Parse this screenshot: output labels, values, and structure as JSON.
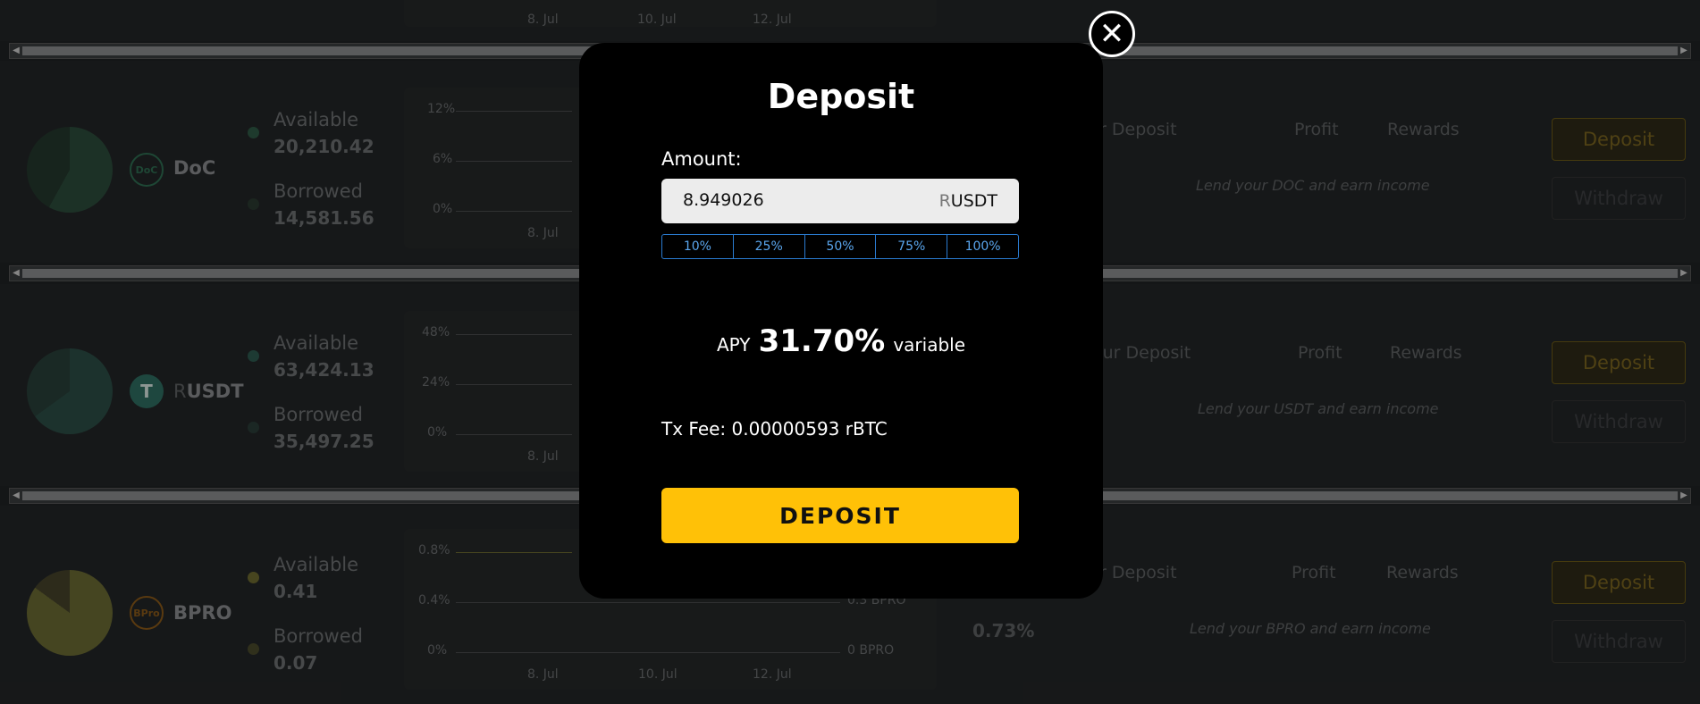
{
  "modal": {
    "title": "Deposit",
    "amount_label": "Amount:",
    "amount_value": "8.949026",
    "amount_unit_prefix": "R",
    "amount_unit": "USDT",
    "percent_options": [
      "10%",
      "25%",
      "50%",
      "75%",
      "100%"
    ],
    "apy_label": "APY",
    "apy_value": "31.70%",
    "apy_type": "variable",
    "tx_fee": "Tx Fee: 0.00000593 rBTC",
    "deposit_button": "DEPOSIT",
    "close_icon": "close-icon"
  },
  "background": {
    "top_row": {
      "ticks": [
        "8. Jul",
        "10. Jul",
        "12. Jul"
      ]
    },
    "markets": [
      {
        "coin": "DoC",
        "icon_text": "DoC",
        "available_label": "Available",
        "available": "20,210.42",
        "borrowed_label": "Borrowed",
        "borrowed": "14,581.56",
        "y_ticks": [
          "12%",
          "6%",
          "0%"
        ],
        "x_ticks": [
          "8. Jul"
        ],
        "columns": [
          "ur Deposit",
          "Profit",
          "Rewards"
        ],
        "note": "Lend your DOC and earn income",
        "deposit": "Deposit",
        "withdraw": "Withdraw",
        "color": "#2f5a45"
      },
      {
        "coin": "USDT",
        "coin_prefix": "R",
        "icon_text": "T",
        "available_label": "Available",
        "available": "63,424.13",
        "borrowed_label": "Borrowed",
        "borrowed": "35,497.25",
        "y_ticks": [
          "48%",
          "24%",
          "0%"
        ],
        "x_ticks": [
          "8. Jul"
        ],
        "columns": [
          "our Deposit",
          "Profit",
          "Rewards"
        ],
        "note": "Lend your USDT and earn income",
        "deposit": "Deposit",
        "withdraw": "Withdraw",
        "color": "#3c6f62"
      },
      {
        "coin": "BPRO",
        "icon_text": "BPro",
        "available_label": "Available",
        "available": "0.41",
        "borrowed_label": "Borrowed",
        "borrowed": "0.07",
        "y_ticks": [
          "0.8%",
          "0.4%",
          "0%"
        ],
        "x_ticks": [
          "8. Jul",
          "10. Jul",
          "12. Jul"
        ],
        "right_ticks": [
          "0.3 BPRO",
          "0 BPRO"
        ],
        "apy": "0.73%",
        "columns": [
          "ur Deposit",
          "Profit",
          "Rewards"
        ],
        "note": "Lend your BPRO and earn income",
        "deposit": "Deposit",
        "withdraw": "Withdraw",
        "color": "#6e6a30"
      }
    ]
  },
  "colors": {
    "accent": "#ffc107",
    "pct_border": "#2a7bd0",
    "modal_bg": "#000000"
  }
}
